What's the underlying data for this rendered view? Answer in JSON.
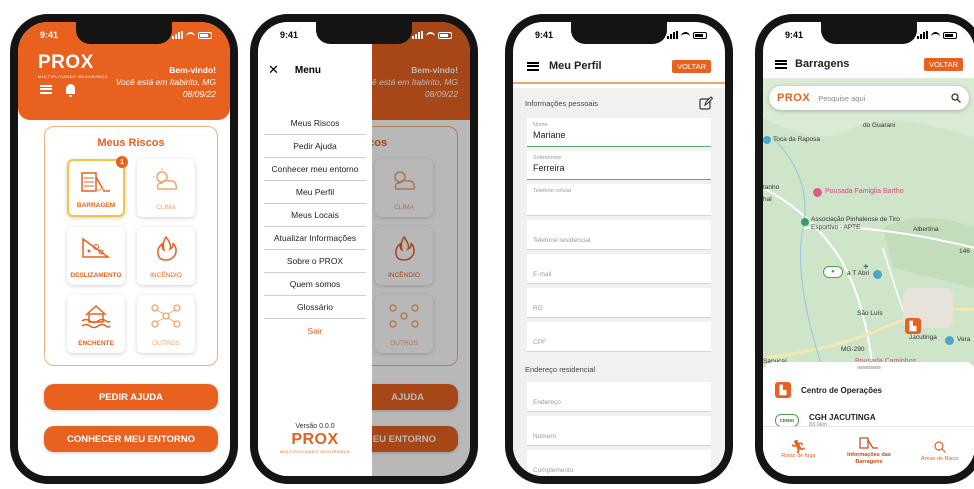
{
  "status_time": "9:41",
  "colors": {
    "accent": "#e8611f",
    "accent_light": "#f0b07e",
    "map_green": "#cfe5c9",
    "highlight": "#f5c542"
  },
  "logo": {
    "text": "PROX",
    "tagline": "MULTIPLICANDO SEGURANÇA"
  },
  "home": {
    "welcome": "Bem-vindo!",
    "location": "Você está em Itabirito, MG",
    "date": "08/09/22",
    "riscos_title": "Meus Riscos",
    "tiles": [
      {
        "label": "BARRAGEM",
        "icon": "dam-icon",
        "badge": "1"
      },
      {
        "label": "CLIMA",
        "icon": "weather-icon"
      },
      {
        "label": "DESLIZAMENTO",
        "icon": "landslide-icon"
      },
      {
        "label": "INCÊNDIO",
        "icon": "fire-icon"
      },
      {
        "label": "ENCHENTE",
        "icon": "flood-icon"
      },
      {
        "label": "OUTROS",
        "icon": "network-icon"
      }
    ],
    "btn_help": "PEDIR AJUDA",
    "btn_env": "CONHECER MEU ENTORNO"
  },
  "menu": {
    "title": "Menu",
    "items": [
      "Meus Riscos",
      "Pedir Ajuda",
      "Conhecer meu entorno",
      "Meu Perfil",
      "Meus Locais",
      "Atualizar Informações",
      "Sobre o PROX",
      "Quem somos",
      "Glossário"
    ],
    "logout": "Sair",
    "version": "Versão 0.0.0",
    "bg_welcome": "Bem-vindo!",
    "bg_location": "ocê está em Itabirito, MG",
    "bg_date": "08/09/22",
    "bg_riscos": "iscos",
    "bg_clima": "CLIMA",
    "bg_incendio": "INCÊNDIO",
    "bg_outros": "OUTROS",
    "bg_help": "AJUDA",
    "bg_env": "EU ENTORNO"
  },
  "profile": {
    "title": "Meu Perfil",
    "back": "VOLTAR",
    "personal_section": "Informações pessoais",
    "name_label": "Nome",
    "name_value": "Mariane",
    "surname_label": "Sobrenome",
    "surname_value": "Ferreira",
    "phone_label": "Telefone celular",
    "home_phone": "Telefone residencial",
    "email": "E-mail",
    "rg": "RG",
    "cpf": "CPF",
    "address_section": "Endereço residencial",
    "address": "Endereço",
    "number": "Número",
    "complement": "Complemento"
  },
  "dams": {
    "title": "Barragens",
    "back": "VOLTAR",
    "search_placeholder": "Pesquise aqui",
    "map_labels": {
      "toca": "Toca da Raposa",
      "guarani": "do Guarani",
      "pousada_bartho": "Pousada Famiglia Bartho",
      "assoc": "Associação Pinhalense de Tiro Esportivo - APTE",
      "albertina": "Albertina",
      "abrio": "a T Abri",
      "sao_luis": "São Luís",
      "jacutinga": "Jacutinga",
      "vera": "Vera",
      "sapucai": "Sapucaí",
      "pousada_caminhos": "Pousada Caminhos",
      "mg290": "MG-290",
      "etanho": "tanho",
      "hal": "hal",
      "r146": "146"
    },
    "list": [
      {
        "title": "Centro de Operações",
        "sub": ""
      },
      {
        "title": "CGH JACUTINGA",
        "sub": "83.9km",
        "tag": "CEMIG"
      }
    ],
    "nav": [
      {
        "label": "Rotas de fuga",
        "icon": "running-person-icon"
      },
      {
        "label": "Informações das Barragens",
        "icon": "dam-icon"
      },
      {
        "label": "Áreas de Risco",
        "icon": "search-risk-icon"
      }
    ]
  }
}
